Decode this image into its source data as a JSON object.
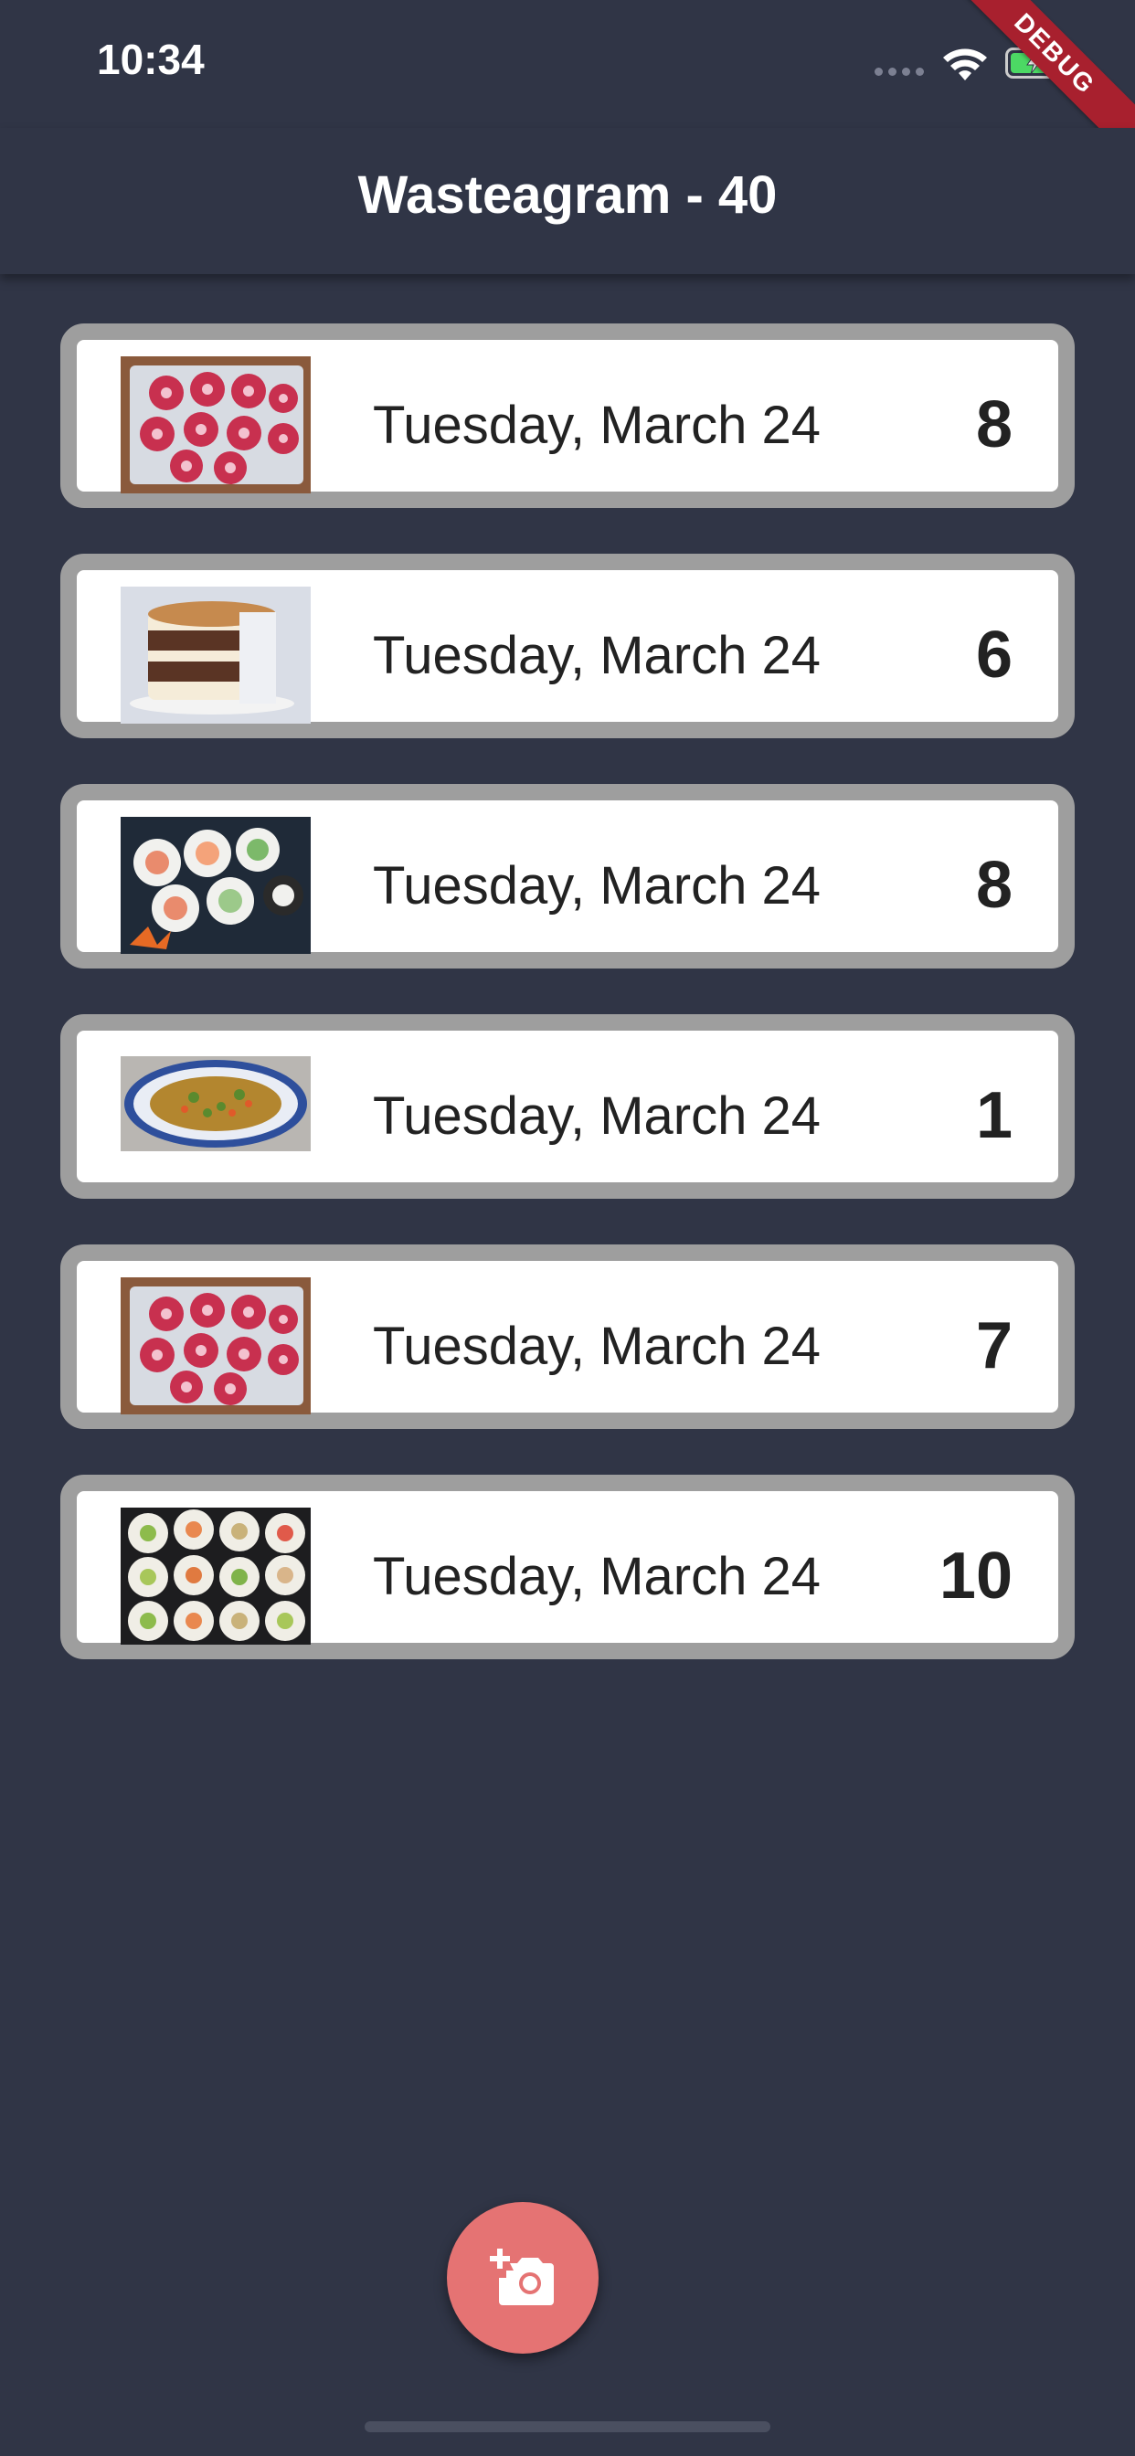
{
  "status_bar": {
    "time": "10:34",
    "debug_label": "DEBUG"
  },
  "app_bar": {
    "title": "Wasteagram - 40"
  },
  "entries": [
    {
      "date": "Tuesday, March 24",
      "count": "8",
      "photo": "donuts-photo"
    },
    {
      "date": "Tuesday, March 24",
      "count": "6",
      "photo": "cake-photo"
    },
    {
      "date": "Tuesday, March 24",
      "count": "8",
      "photo": "sushi-rolls-photo"
    },
    {
      "date": "Tuesday, March 24",
      "count": "1",
      "photo": "salad-platter-photo"
    },
    {
      "date": "Tuesday, March 24",
      "count": "7",
      "photo": "donuts-photo"
    },
    {
      "date": "Tuesday, March 24",
      "count": "10",
      "photo": "sushi-platter-photo"
    }
  ],
  "fab": {
    "icon": "add-a-photo-icon"
  },
  "colors": {
    "background": "#303546",
    "card_border": "#9e9e9e",
    "fab": "#e57373",
    "debug_ribbon": "#a8202e"
  }
}
